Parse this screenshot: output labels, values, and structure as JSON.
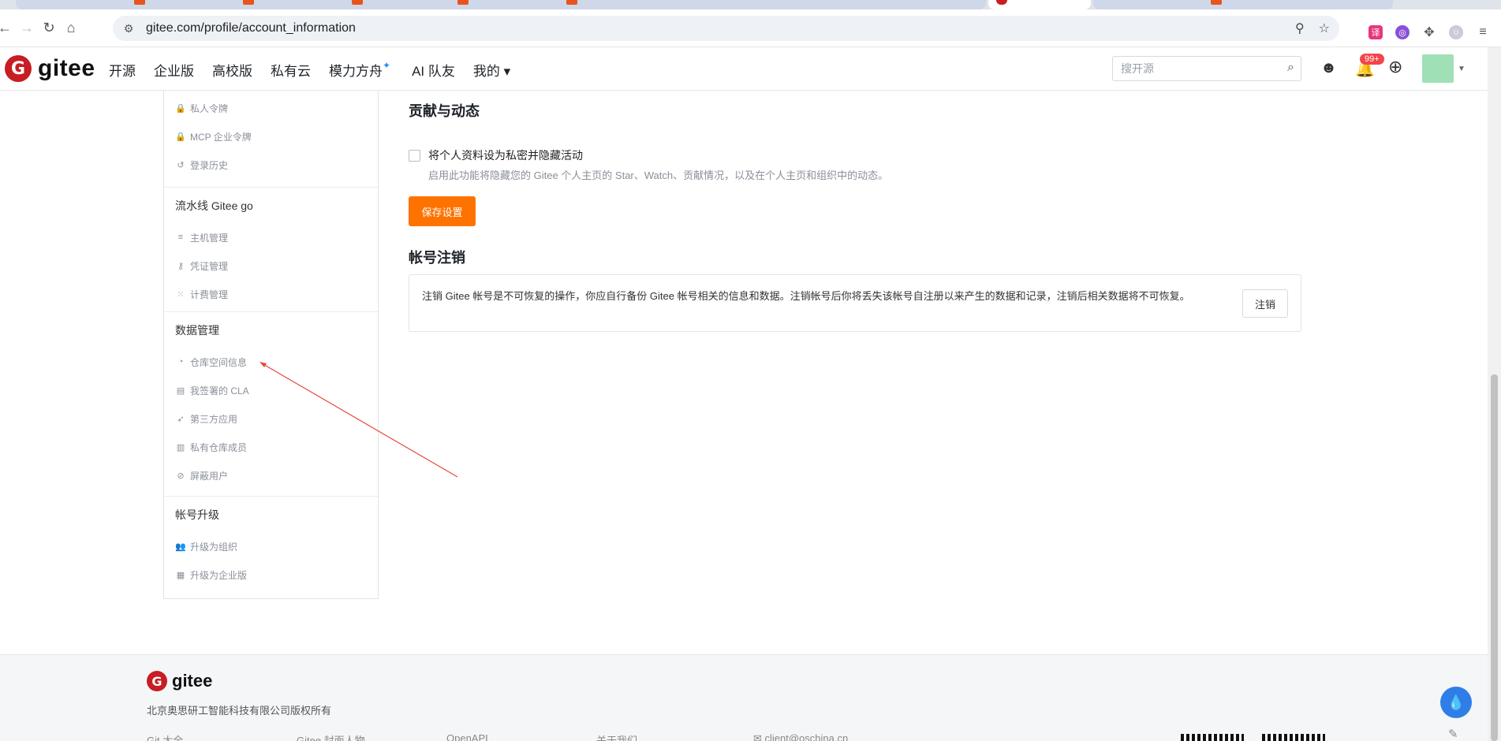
{
  "browser": {
    "url": "gitee.com/profile/account_information",
    "back_glyph": "←",
    "forward_glyph": "→",
    "reload_glyph": "↻",
    "home_glyph": "⌂"
  },
  "header": {
    "logo_mark": "G",
    "logo_text": "gitee",
    "nav": [
      "开源",
      "企业版",
      "高校版",
      "私有云",
      "模力方舟",
      "AI 队友",
      "我的 ▾"
    ],
    "sparkle": "✦",
    "search_placeholder": "搜开源",
    "notifications_badge": "99+"
  },
  "sidebar": {
    "top_items": [
      {
        "icon": "lock-icon",
        "glyph": "🔒",
        "label": "私人令牌"
      },
      {
        "icon": "lock-icon",
        "glyph": "🔒",
        "label": "MCP 企业令牌"
      },
      {
        "icon": "history-icon",
        "glyph": "↺",
        "label": "登录历史"
      }
    ],
    "sections": [
      {
        "title": "流水线 Gitee go",
        "items": [
          {
            "icon": "server-icon",
            "glyph": "≡",
            "label": "主机管理"
          },
          {
            "icon": "key-icon",
            "glyph": "⚷",
            "label": "凭证管理"
          },
          {
            "icon": "schedule-icon",
            "glyph": "⁙",
            "label": "计费管理"
          }
        ]
      },
      {
        "title": "数据管理",
        "items": [
          {
            "icon": "pie-chart-icon",
            "glyph": "◔",
            "label": "仓库空间信息"
          },
          {
            "icon": "document-icon",
            "glyph": "▤",
            "label": "我签署的 CLA"
          },
          {
            "icon": "rocket-icon",
            "glyph": "➶",
            "label": "第三方应用"
          },
          {
            "icon": "book-icon",
            "glyph": "▥",
            "label": "私有仓库成员"
          },
          {
            "icon": "block-icon",
            "glyph": "⊘",
            "label": "屏蔽用户"
          }
        ]
      },
      {
        "title": "帐号升级",
        "items": [
          {
            "icon": "group-icon",
            "glyph": "👥",
            "label": "升级为组织"
          },
          {
            "icon": "building-icon",
            "glyph": "▦",
            "label": "升级为企业版"
          }
        ]
      }
    ]
  },
  "main": {
    "contrib_title": "贡献与动态",
    "privacy_label": "将个人资料设为私密并隐藏活动",
    "privacy_hint": "启用此功能将隐藏您的 Gitee 个人主页的 Star、Watch、贡献情况，以及在个人主页和组织中的动态。",
    "save_label": "保存设置",
    "cancel_title": "帐号注销",
    "cancel_text": "注销 Gitee 帐号是不可恢复的操作，你应自行备份 Gitee 帐号相关的信息和数据。注销帐号后你将丢失该帐号自注册以来产生的数据和记录，注销后相关数据将不可恢复。",
    "cancel_button": "注销"
  },
  "footer": {
    "logo_text": "gitee",
    "copyright": "北京奥思研工智能科技有限公司版权所有",
    "links": [
      "Git 大全",
      "Gitee 封面人物",
      "OpenAPI",
      "关于我们"
    ],
    "email": "client@oschina.cn"
  },
  "colors": {
    "brand": "#c71d23",
    "save_button": "#fe7300",
    "annotation_arrow": "#e8473c"
  }
}
